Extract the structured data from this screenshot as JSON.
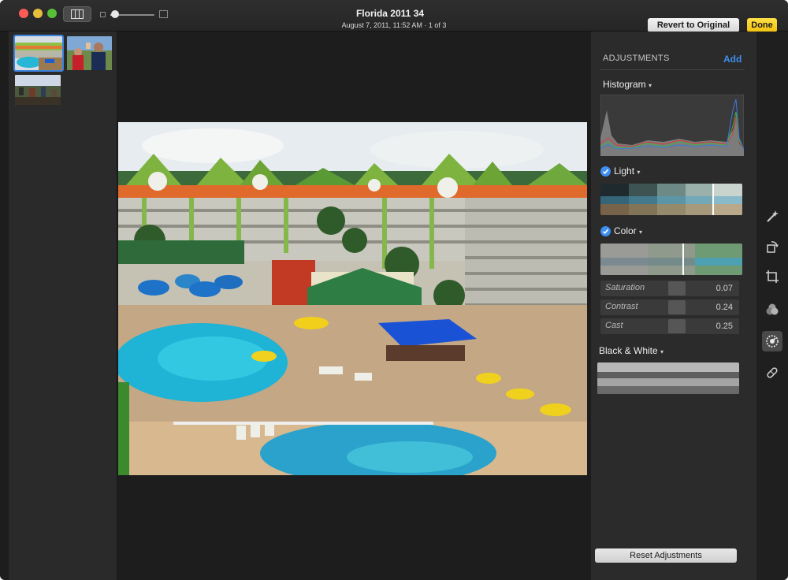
{
  "window": {
    "title": "Florida 2011 34",
    "subtitle": "August 7, 2011, 11:52 AM  ·  1 of 3"
  },
  "toolbar": {
    "revert_label": "Revert to Original",
    "done_label": "Done",
    "zoom_level": 0.1
  },
  "adjustments": {
    "title": "ADJUSTMENTS",
    "add_label": "Add",
    "histogram_label": "Histogram",
    "sections": {
      "light": {
        "label": "Light",
        "enabled": true
      },
      "color": {
        "label": "Color",
        "enabled": true,
        "sliders": [
          {
            "label": "Saturation",
            "value": "0.07"
          },
          {
            "label": "Contrast",
            "value": "0.24"
          },
          {
            "label": "Cast",
            "value": "0.25"
          }
        ]
      },
      "bw": {
        "label": "Black & White",
        "enabled": false
      }
    },
    "reset_label": "Reset Adjustments"
  },
  "icons": {
    "tools": [
      "magic-wand-icon",
      "rotate-icon",
      "crop-icon",
      "filters-icon",
      "adjust-icon",
      "retouch-icon"
    ]
  },
  "colors": {
    "accent": "#3d8ff0",
    "done": "#f3c20b",
    "selection": "#3b82e0"
  }
}
